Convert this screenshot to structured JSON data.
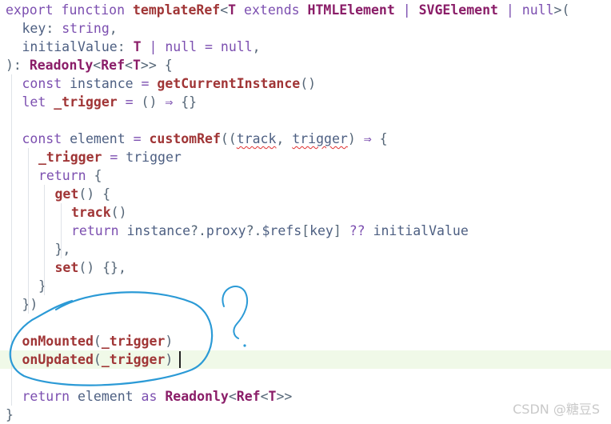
{
  "editor": {
    "lines": [
      {
        "indent": 0,
        "tokens": [
          [
            "export ",
            "k"
          ],
          [
            "function ",
            "k"
          ],
          [
            "templateRef",
            "f"
          ],
          [
            "<",
            "p"
          ],
          [
            "T",
            "ty"
          ],
          [
            " extends ",
            "k"
          ],
          [
            "HTMLElement",
            "ty"
          ],
          [
            " | ",
            "o"
          ],
          [
            "SVGElement",
            "ty"
          ],
          [
            " | ",
            "o"
          ],
          [
            "null",
            "k"
          ],
          [
            ">(",
            "p"
          ]
        ]
      },
      {
        "indent": 1,
        "tokens": [
          [
            "key",
            "v"
          ],
          [
            ": ",
            "p"
          ],
          [
            "string",
            "k"
          ],
          [
            ",",
            "p"
          ]
        ]
      },
      {
        "indent": 1,
        "tokens": [
          [
            "initialValue",
            "v"
          ],
          [
            ": ",
            "p"
          ],
          [
            "T",
            "ty"
          ],
          [
            " | ",
            "o"
          ],
          [
            "null",
            "k"
          ],
          [
            " = ",
            "o"
          ],
          [
            "null",
            "k"
          ],
          [
            ",",
            "p"
          ]
        ]
      },
      {
        "indent": 0,
        "tokens": [
          "): ",
          "p"
        ],
        "tokensFix": true
      },
      {
        "indent": 1,
        "tokens": [
          [
            "const ",
            "k"
          ],
          [
            "instance",
            "v"
          ],
          [
            " = ",
            "o"
          ],
          [
            "getCurrentInstance",
            "f"
          ],
          [
            "()",
            "p"
          ]
        ]
      },
      {
        "indent": 1,
        "tokens": [
          [
            "let ",
            "k"
          ],
          [
            "_trigger",
            "f"
          ],
          [
            " = ",
            "o"
          ],
          [
            "() ",
            "p"
          ],
          [
            "⇒ ",
            "o"
          ],
          [
            "{}",
            "p"
          ]
        ]
      },
      {
        "indent": 0,
        "tokens": []
      },
      {
        "indent": 1,
        "tokens": [
          [
            "const ",
            "k"
          ],
          [
            "element",
            "v"
          ],
          [
            " = ",
            "o"
          ],
          [
            "customRef",
            "f"
          ],
          [
            "((",
            "p"
          ],
          [
            "track",
            "v",
            "ul"
          ],
          [
            ", ",
            "p"
          ],
          [
            "trigger",
            "v",
            "ul"
          ],
          [
            ") ",
            "p"
          ],
          [
            "⇒ ",
            "o"
          ],
          [
            "{",
            "p"
          ]
        ]
      },
      {
        "indent": 2,
        "tokens": [
          [
            "_trigger",
            "f"
          ],
          [
            " = ",
            "o"
          ],
          [
            "trigger",
            "v"
          ]
        ]
      },
      {
        "indent": 2,
        "tokens": [
          [
            "return ",
            "k"
          ],
          [
            "{",
            "p"
          ]
        ]
      },
      {
        "indent": 3,
        "tokens": [
          [
            "get",
            "f"
          ],
          [
            "() {",
            "p"
          ]
        ]
      },
      {
        "indent": 4,
        "tokens": [
          [
            "track",
            "f"
          ],
          [
            "()",
            "p"
          ]
        ]
      },
      {
        "indent": 4,
        "tokens": [
          [
            "return ",
            "k"
          ],
          [
            "instance",
            "v"
          ],
          [
            "?.",
            "p"
          ],
          [
            "proxy",
            "v"
          ],
          [
            "?.",
            "p"
          ],
          [
            "$refs",
            "v"
          ],
          [
            "[",
            "p"
          ],
          [
            "key",
            "v"
          ],
          [
            "] ",
            "p"
          ],
          [
            "??",
            "o"
          ],
          [
            " initialValue",
            "v"
          ]
        ]
      },
      {
        "indent": 3,
        "tokens": [
          [
            "},",
            "p"
          ]
        ]
      },
      {
        "indent": 3,
        "tokens": [
          [
            "set",
            "f"
          ],
          [
            "() {},",
            "p"
          ]
        ]
      },
      {
        "indent": 2,
        "tokens": [
          [
            "}",
            "p"
          ]
        ]
      },
      {
        "indent": 1,
        "tokens": [
          [
            "})",
            "p"
          ]
        ]
      },
      {
        "indent": 0,
        "tokens": []
      },
      {
        "indent": 1,
        "tokens": [
          [
            "onMounted",
            "f"
          ],
          [
            "(",
            "p"
          ],
          [
            "_trigger",
            "f"
          ],
          [
            ")",
            "p"
          ]
        ]
      },
      {
        "indent": 1,
        "tokens": [
          [
            "onUpdated",
            "f"
          ],
          [
            "(",
            "p"
          ],
          [
            "_trigger",
            "f"
          ],
          [
            ")",
            "p"
          ]
        ],
        "active": true
      },
      {
        "indent": 0,
        "tokens": []
      },
      {
        "indent": 1,
        "tokens": [
          [
            "return ",
            "k"
          ],
          [
            "element",
            "v"
          ],
          [
            " as ",
            "k"
          ],
          [
            "Readonly",
            "ty"
          ],
          [
            "<",
            "p"
          ],
          [
            "Ref",
            "ty"
          ],
          [
            "<",
            "p"
          ],
          [
            "T",
            "ty"
          ],
          [
            ">>",
            "p"
          ]
        ]
      },
      {
        "indent": 0,
        "tokens": [
          [
            "}",
            "p"
          ]
        ]
      }
    ],
    "line3": [
      [
        "): ",
        "p"
      ],
      [
        "Readonly",
        "ty"
      ],
      [
        "<",
        "p"
      ],
      [
        "Ref",
        "ty"
      ],
      [
        "<",
        "p"
      ],
      [
        "T",
        "ty"
      ],
      [
        ">> ",
        "p"
      ],
      [
        "{",
        "p"
      ]
    ],
    "annotation": {
      "question_mark": "?",
      "color": "#2b9ad6"
    }
  },
  "watermark": "CSDN @糖豆S",
  "colors": {
    "keyword": "#7c4fb0",
    "function": "#a03536",
    "type": "#8a1d68",
    "identifier": "#4d5f82",
    "active_line": "#f0f9e8",
    "annotation": "#2b9ad6"
  }
}
